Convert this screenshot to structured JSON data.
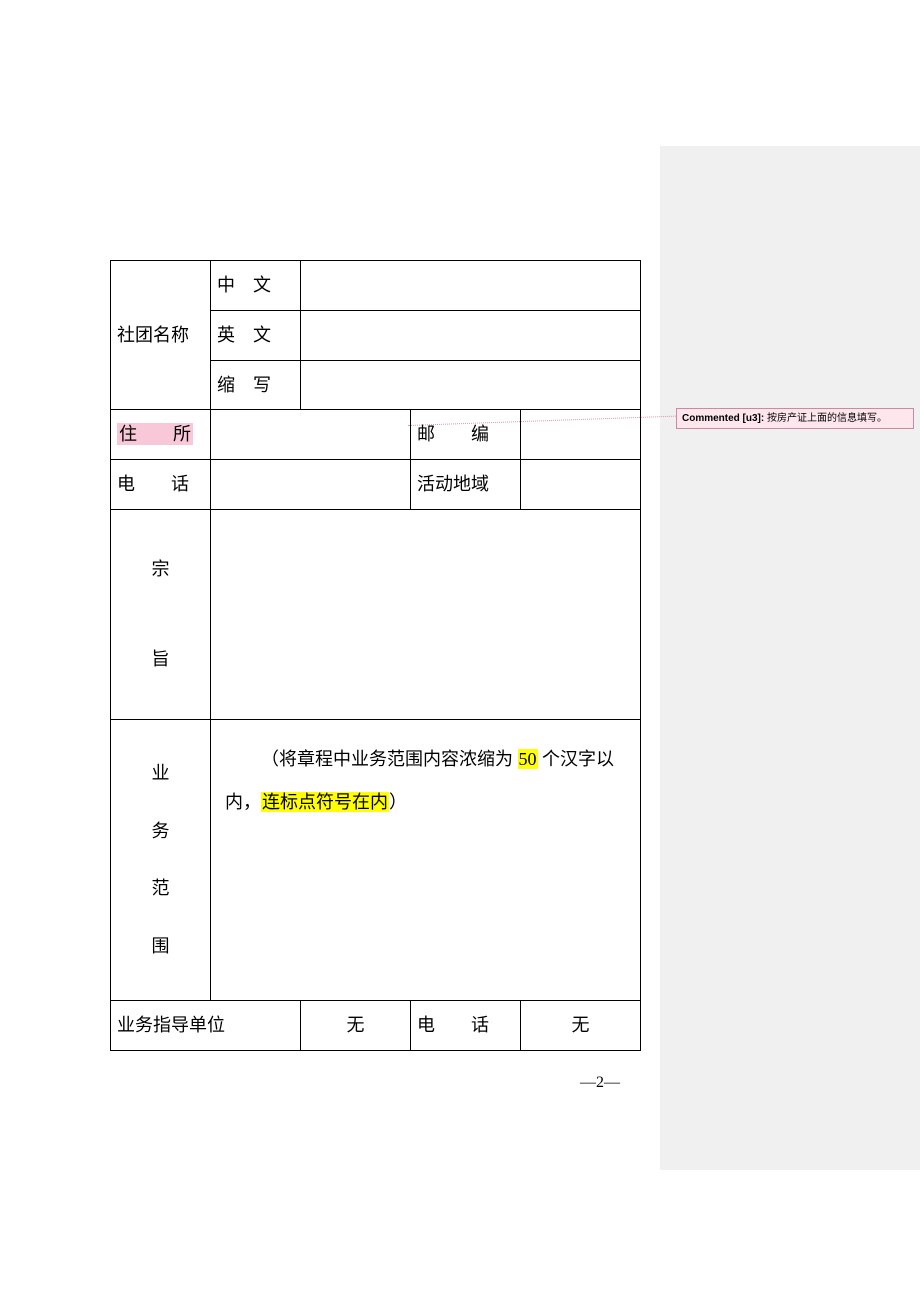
{
  "rows": {
    "org_name_label": "社团名称",
    "name_cn_label": "中　文",
    "name_cn_value": "",
    "name_en_label": "英　文",
    "name_en_value": "",
    "name_abbr_label": "缩　写",
    "name_abbr_value": "",
    "address_label": "住　　所",
    "address_value": "",
    "postcode_label": "邮　　编",
    "postcode_value": "",
    "phone_label": "电　　话",
    "phone_value": "",
    "area_label": "活动地域",
    "area_value": "",
    "purpose_label_1": "宗",
    "purpose_label_2": "旨",
    "purpose_value": "",
    "scope_label_1": "业",
    "scope_label_2": "务",
    "scope_label_3": "范",
    "scope_label_4": "围",
    "scope_prefix": "（将章程中业务范围内容浓缩为 ",
    "scope_hl_50": "50",
    "scope_mid": " 个汉字以内，",
    "scope_hl_punct": "连标点符号在内",
    "scope_suffix": "）",
    "guide_unit_label": "业务指导单位",
    "guide_unit_value": "无",
    "guide_phone_label": "电　　话",
    "guide_phone_value": "无"
  },
  "comment": {
    "prefix": "Commented [u3]: ",
    "text": "按房产证上面的信息填写。"
  },
  "page_number": "—2—"
}
